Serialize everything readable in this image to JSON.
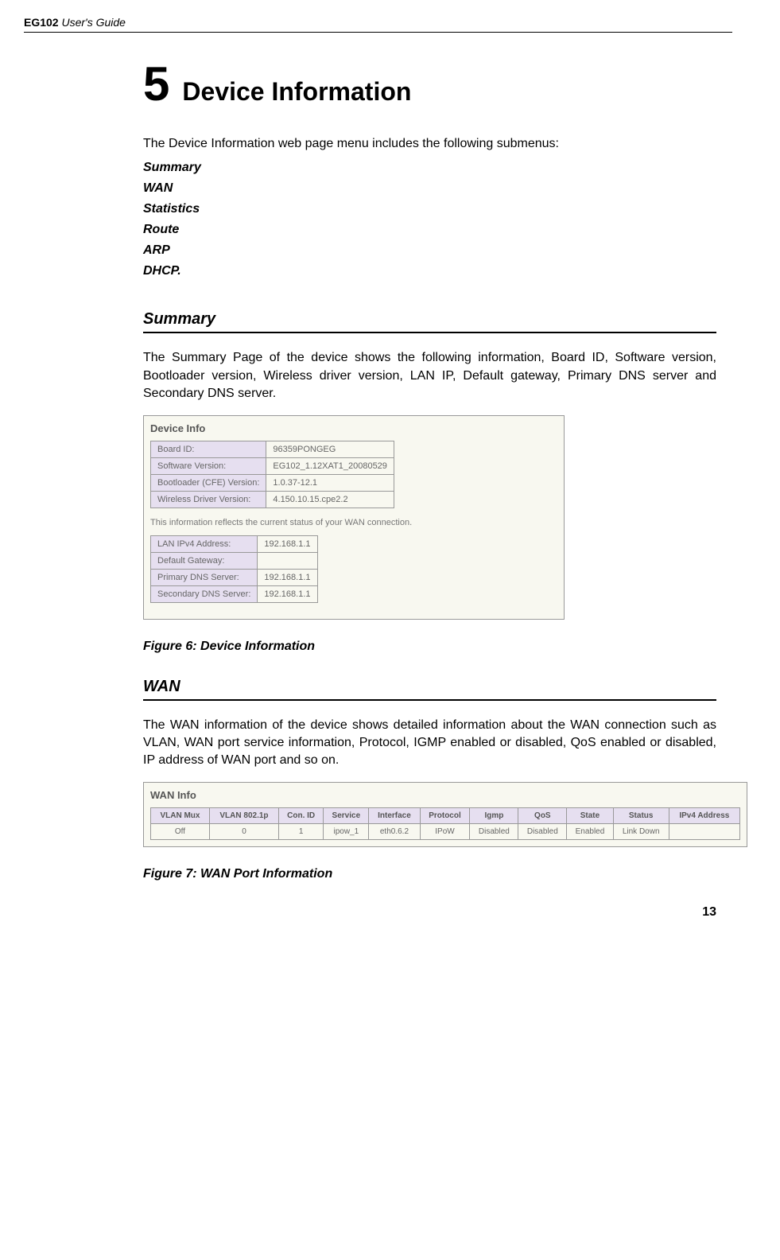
{
  "header": {
    "product": "EG102",
    "suffix": " User's Guide"
  },
  "chapter": {
    "number": "5",
    "title": "Device Information"
  },
  "intro": "The Device Information web page menu includes the following submenus:",
  "submenus": [
    "Summary",
    "WAN",
    "Statistics",
    "Route",
    "ARP",
    "DHCP"
  ],
  "summary": {
    "heading": "Summary",
    "text": "The Summary Page of the device shows the following information, Board ID, Software version, Bootloader version, Wireless driver version, LAN IP, Default gateway, Primary DNS server and Secondary DNS server."
  },
  "device_info": {
    "title": "Device Info",
    "rows1": [
      {
        "label": "Board ID:",
        "value": "96359PONGEG"
      },
      {
        "label": "Software Version:",
        "value": "EG102_1.12XAT1_20080529"
      },
      {
        "label": "Bootloader (CFE) Version:",
        "value": "1.0.37-12.1"
      },
      {
        "label": "Wireless Driver Version:",
        "value": "4.150.10.15.cpe2.2"
      }
    ],
    "note": "This information reflects the current status of your WAN connection.",
    "rows2": [
      {
        "label": "LAN IPv4 Address:",
        "value": "192.168.1.1"
      },
      {
        "label": "Default Gateway:",
        "value": ""
      },
      {
        "label": "Primary DNS Server:",
        "value": "192.168.1.1"
      },
      {
        "label": "Secondary DNS Server:",
        "value": "192.168.1.1"
      }
    ]
  },
  "figure6": "Figure 6: Device Information",
  "wan": {
    "heading": "WAN",
    "text": "The WAN information of the device shows detailed information about the WAN connection such as VLAN, WAN port service information, Protocol, IGMP enabled or disabled, QoS enabled or disabled, IP address of WAN port and so on."
  },
  "wan_info": {
    "title": "WAN Info",
    "headers": [
      "VLAN Mux",
      "VLAN 802.1p",
      "Con. ID",
      "Service",
      "Interface",
      "Protocol",
      "Igmp",
      "QoS",
      "State",
      "Status",
      "IPv4 Address"
    ],
    "row": [
      "Off",
      "0",
      "1",
      "ipow_1",
      "eth0.6.2",
      "IPoW",
      "Disabled",
      "Disabled",
      "Enabled",
      "Link Down",
      ""
    ]
  },
  "figure7": "Figure 7: WAN Port Information",
  "page_number": "13"
}
